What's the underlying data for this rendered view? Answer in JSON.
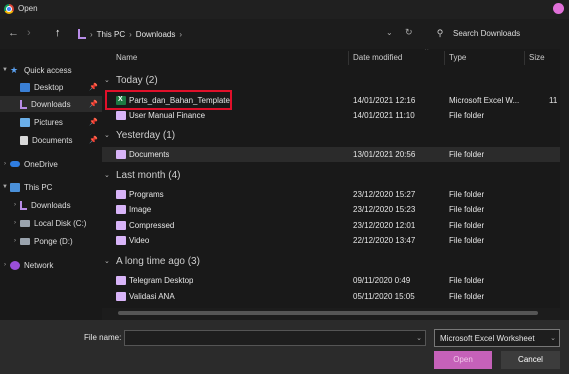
{
  "window": {
    "title": "Open"
  },
  "nav": {
    "back": "←",
    "forward": "›",
    "up": "↑",
    "breadcrumb": [
      "This PC",
      "Downloads"
    ],
    "addr_dropdown": "⌄",
    "refresh": "↻",
    "search_placeholder": "Search Downloads"
  },
  "sidebar": {
    "items": [
      {
        "label": "Quick access",
        "icon": "star-icon",
        "chevron": "▼",
        "pinned": false
      },
      {
        "label": "Desktop",
        "icon": "desktop-icon",
        "chevron": "",
        "pinned": true
      },
      {
        "label": "Downloads",
        "icon": "download-icon",
        "chevron": "",
        "pinned": true,
        "active": true
      },
      {
        "label": "Pictures",
        "icon": "pictures-icon",
        "chevron": "",
        "pinned": true
      },
      {
        "label": "Documents",
        "icon": "documents-icon",
        "chevron": "",
        "pinned": true
      },
      {
        "label": "OneDrive",
        "icon": "cloud-icon",
        "chevron": "›",
        "pinned": false
      },
      {
        "label": "This PC",
        "icon": "pc-icon",
        "chevron": "▼",
        "pinned": false
      },
      {
        "label": "Downloads",
        "icon": "download-icon",
        "chevron": "›",
        "pinned": false
      },
      {
        "label": "Local Disk (C:)",
        "icon": "disk-icon",
        "chevron": "›",
        "pinned": false
      },
      {
        "label": "Ponge (D:)",
        "icon": "disk-icon",
        "chevron": "›",
        "pinned": false
      },
      {
        "label": "Network",
        "icon": "network-icon",
        "chevron": "›",
        "pinned": false
      }
    ],
    "pin_glyph": "📌"
  },
  "columns": {
    "name": "Name",
    "date": "Date modified",
    "type": "Type",
    "size": "Size",
    "sort_caret": "^"
  },
  "groups": [
    {
      "label": "Today (2)",
      "chevron": "⌄"
    },
    {
      "label": "Yesterday (1)",
      "chevron": "⌄"
    },
    {
      "label": "Last month (4)",
      "chevron": "⌄"
    },
    {
      "label": "A long time ago (3)",
      "chevron": "⌄"
    }
  ],
  "files": [
    {
      "name": "Parts_dan_Bahan_Template",
      "date": "14/01/2021 12:16",
      "type": "Microsoft Excel W...",
      "size": "11",
      "icon": "excel-icon"
    },
    {
      "name": "User Manual Finance",
      "date": "14/01/2021 11:10",
      "type": "File folder",
      "size": "",
      "icon": "folder-icon"
    },
    {
      "name": "Documents",
      "date": "13/01/2021 20:56",
      "type": "File folder",
      "size": "",
      "icon": "folder-icon"
    },
    {
      "name": "Programs",
      "date": "23/12/2020 15:27",
      "type": "File folder",
      "size": "",
      "icon": "folder-icon"
    },
    {
      "name": "Image",
      "date": "23/12/2020 15:23",
      "type": "File folder",
      "size": "",
      "icon": "folder-icon"
    },
    {
      "name": "Compressed",
      "date": "23/12/2020 12:01",
      "type": "File folder",
      "size": "",
      "icon": "folder-icon"
    },
    {
      "name": "Video",
      "date": "22/12/2020 13:47",
      "type": "File folder",
      "size": "",
      "icon": "folder-icon"
    },
    {
      "name": "Telegram Desktop",
      "date": "09/11/2020 0:49",
      "type": "File folder",
      "size": "",
      "icon": "folder-icon"
    },
    {
      "name": "Validasi ANA",
      "date": "05/11/2020 15:05",
      "type": "File folder",
      "size": "",
      "icon": "folder-icon"
    }
  ],
  "footer": {
    "filename_label": "File name:",
    "filename_value": "",
    "filetype": "Microsoft Excel Worksheet",
    "dropdown_glyph": "⌄",
    "open": "Open",
    "cancel": "Cancel"
  },
  "colors": {
    "accent": "#c561b9",
    "highlight_box": "#e0102a",
    "folder": "#d8b4f8"
  }
}
